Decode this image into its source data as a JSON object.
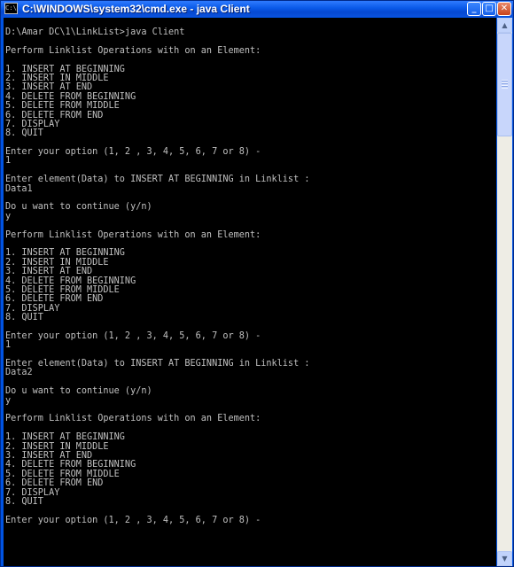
{
  "window": {
    "title": "C:\\WINDOWS\\system32\\cmd.exe - java Client",
    "icon": "cmd-icon",
    "buttons": {
      "minimize": "_",
      "maximize": "□",
      "close": "✕"
    }
  },
  "console": {
    "lines": [
      "D:\\Amar DC\\1\\LinkList>java Client",
      "",
      "Perform Linklist Operations with on an Element:",
      "",
      "1. INSERT AT BEGINNING",
      "2. INSERT IN MIDDLE",
      "3. INSERT AT END",
      "4. DELETE FROM BEGINNING",
      "5. DELETE FROM MIDDLE",
      "6. DELETE FROM END",
      "7. DISPLAY",
      "8. QUIT",
      "",
      "Enter your option (1, 2 , 3, 4, 5, 6, 7 or 8) -",
      "1",
      "",
      "Enter element(Data) to INSERT AT BEGINNING in Linklist :",
      "Data1",
      "",
      "Do u want to continue (y/n)",
      "y",
      "",
      "Perform Linklist Operations with on an Element:",
      "",
      "1. INSERT AT BEGINNING",
      "2. INSERT IN MIDDLE",
      "3. INSERT AT END",
      "4. DELETE FROM BEGINNING",
      "5. DELETE FROM MIDDLE",
      "6. DELETE FROM END",
      "7. DISPLAY",
      "8. QUIT",
      "",
      "Enter your option (1, 2 , 3, 4, 5, 6, 7 or 8) -",
      "1",
      "",
      "Enter element(Data) to INSERT AT BEGINNING in Linklist :",
      "Data2",
      "",
      "Do u want to continue (y/n)",
      "y",
      "",
      "Perform Linklist Operations with on an Element:",
      "",
      "1. INSERT AT BEGINNING",
      "2. INSERT IN MIDDLE",
      "3. INSERT AT END",
      "4. DELETE FROM BEGINNING",
      "5. DELETE FROM MIDDLE",
      "6. DELETE FROM END",
      "7. DISPLAY",
      "8. QUIT",
      "",
      "Enter your option (1, 2 , 3, 4, 5, 6, 7 or 8) -"
    ]
  },
  "scrollbar": {
    "up_glyph": "▲",
    "down_glyph": "▼"
  },
  "colors": {
    "console_background": "#000000",
    "console_text": "#c0c0c0",
    "titlebar": "#0a5ae8"
  }
}
